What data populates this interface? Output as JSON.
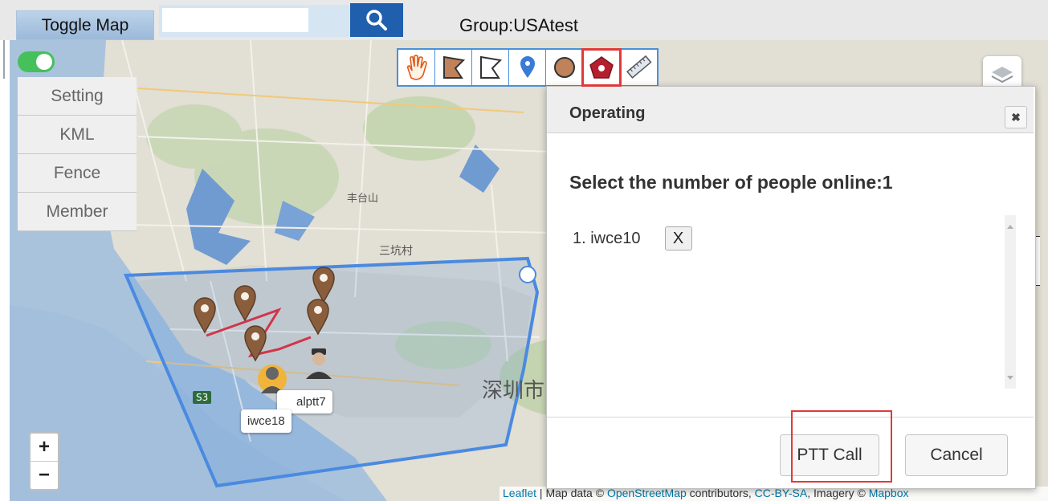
{
  "topbar": {
    "toggle_label": "Toggle Map",
    "search_placeholder": "",
    "group_label": "Group:USAtest"
  },
  "side_menu": {
    "items": [
      {
        "label": "Setting"
      },
      {
        "label": "KML"
      },
      {
        "label": "Fence"
      },
      {
        "label": "Member"
      }
    ]
  },
  "toolbar": {
    "tools": [
      "hand-icon",
      "polygon-fill-icon",
      "polygon-outline-icon",
      "marker-icon",
      "circle-icon",
      "pentagon-icon",
      "ruler-icon"
    ],
    "selected_tool": "pentagon-icon"
  },
  "map": {
    "labels": {
      "fenghuang": "丰台山",
      "sankeng": "三坑村",
      "shenzhen": "深圳市",
      "road_s3": "S3"
    },
    "tooltips": {
      "iwce18": "iwce18",
      "alptt7": "alptt7"
    },
    "attribution": {
      "leaflet": "Leaflet",
      "rest": " | Map data © ",
      "osm": "OpenStreetMap",
      "contrib": " contributors, ",
      "ccbysa": "CC-BY-SA",
      "imagery": ", Imagery © ",
      "mapbox": "Mapbox"
    },
    "zoom_in": "+",
    "zoom_out": "−",
    "fence_color": "#4a8ae0"
  },
  "dialog": {
    "title": "Operating",
    "close_symbol": "✖",
    "heading": "Select the number of people online:1",
    "members": [
      {
        "label": "1. iwce10",
        "remove": "X"
      }
    ],
    "ptt_label": "PTT Call",
    "cancel_label": "Cancel"
  },
  "colors": {
    "highlight": "#e03a3a",
    "toggle_bg": "#a9c5e2",
    "search_button": "#1f5fae",
    "switch_on": "#45c05a"
  }
}
